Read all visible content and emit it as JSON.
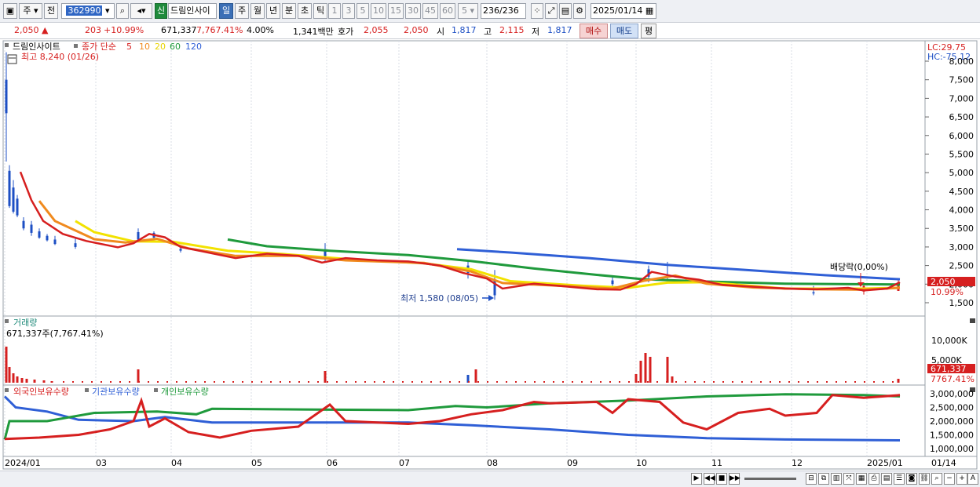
{
  "toolbar": {
    "period_unit": "주",
    "prev_label": "전",
    "code": "362990",
    "new_badge": "신",
    "stock_name": "드림인사이",
    "tabs": [
      "일",
      "주",
      "월",
      "년",
      "분",
      "초",
      "틱"
    ],
    "active_tab": "일",
    "intervals": [
      "1",
      "3",
      "5",
      "10",
      "15",
      "30",
      "45",
      "60"
    ],
    "interval_value": "5",
    "count": "236/236",
    "date": "2025/01/14"
  },
  "quote": {
    "price": "2,050",
    "change": "203",
    "change_pct": "+10.99%",
    "volume": "671,337",
    "volume_pct": "7,767.41%",
    "rate": "4.00%",
    "amount": "1,341백만",
    "hoga_label": "호가",
    "ask": "2,055",
    "bid": "2,050",
    "open_label": "시",
    "open": "1,817",
    "high_label": "고",
    "high": "2,115",
    "low_label": "저",
    "low": "1,817",
    "buy": "매수",
    "sell": "매도",
    "eval": "평"
  },
  "price_panel": {
    "name": "드림인사이트",
    "ma_label": "종가 단순",
    "ma_periods": [
      "5",
      "10",
      "20",
      "60",
      "120"
    ],
    "ma_colors": [
      "#d61f1f",
      "#f08a1e",
      "#e8d400",
      "#1f9a3c",
      "#2f5fd6"
    ],
    "high_note": "최고 8,240 (01/26)",
    "low_note": "최저 1,580 (08/05)",
    "dividend_note": "배당락(0,00%)",
    "lc": "LC:29.75",
    "hc": "HC:-75.12",
    "price_tag": "2,050",
    "pct_tag": "10.99%",
    "y_ticks": [
      "8,000",
      "7,500",
      "7,000",
      "6,500",
      "6,000",
      "5,500",
      "5,000",
      "4,500",
      "4,000",
      "3,500",
      "3,000",
      "2,500",
      "2,000",
      "1,500"
    ]
  },
  "volume_panel": {
    "title": "거래량",
    "note": "671,337주(7,767.41%)",
    "y_ticks": [
      "10,000K",
      "5,000K"
    ],
    "value_tag": "671,337",
    "pct_tag": "7767.41%"
  },
  "holdings_panel": {
    "legend": [
      "외국인보유수량",
      "기관보유수량",
      "개인보유수량"
    ],
    "colors": [
      "#d61f1f",
      "#2f5fd6",
      "#1f9a3c"
    ],
    "y_ticks": [
      "3,000,000",
      "2,500,000",
      "2,000,000",
      "1,500,000",
      "1,000,000"
    ]
  },
  "x_axis": {
    "labels": [
      "2024/01",
      "03",
      "04",
      "05",
      "06",
      "07",
      "08",
      "09",
      "10",
      "11",
      "12",
      "2025/01"
    ],
    "right_label": "01/14"
  }
}
